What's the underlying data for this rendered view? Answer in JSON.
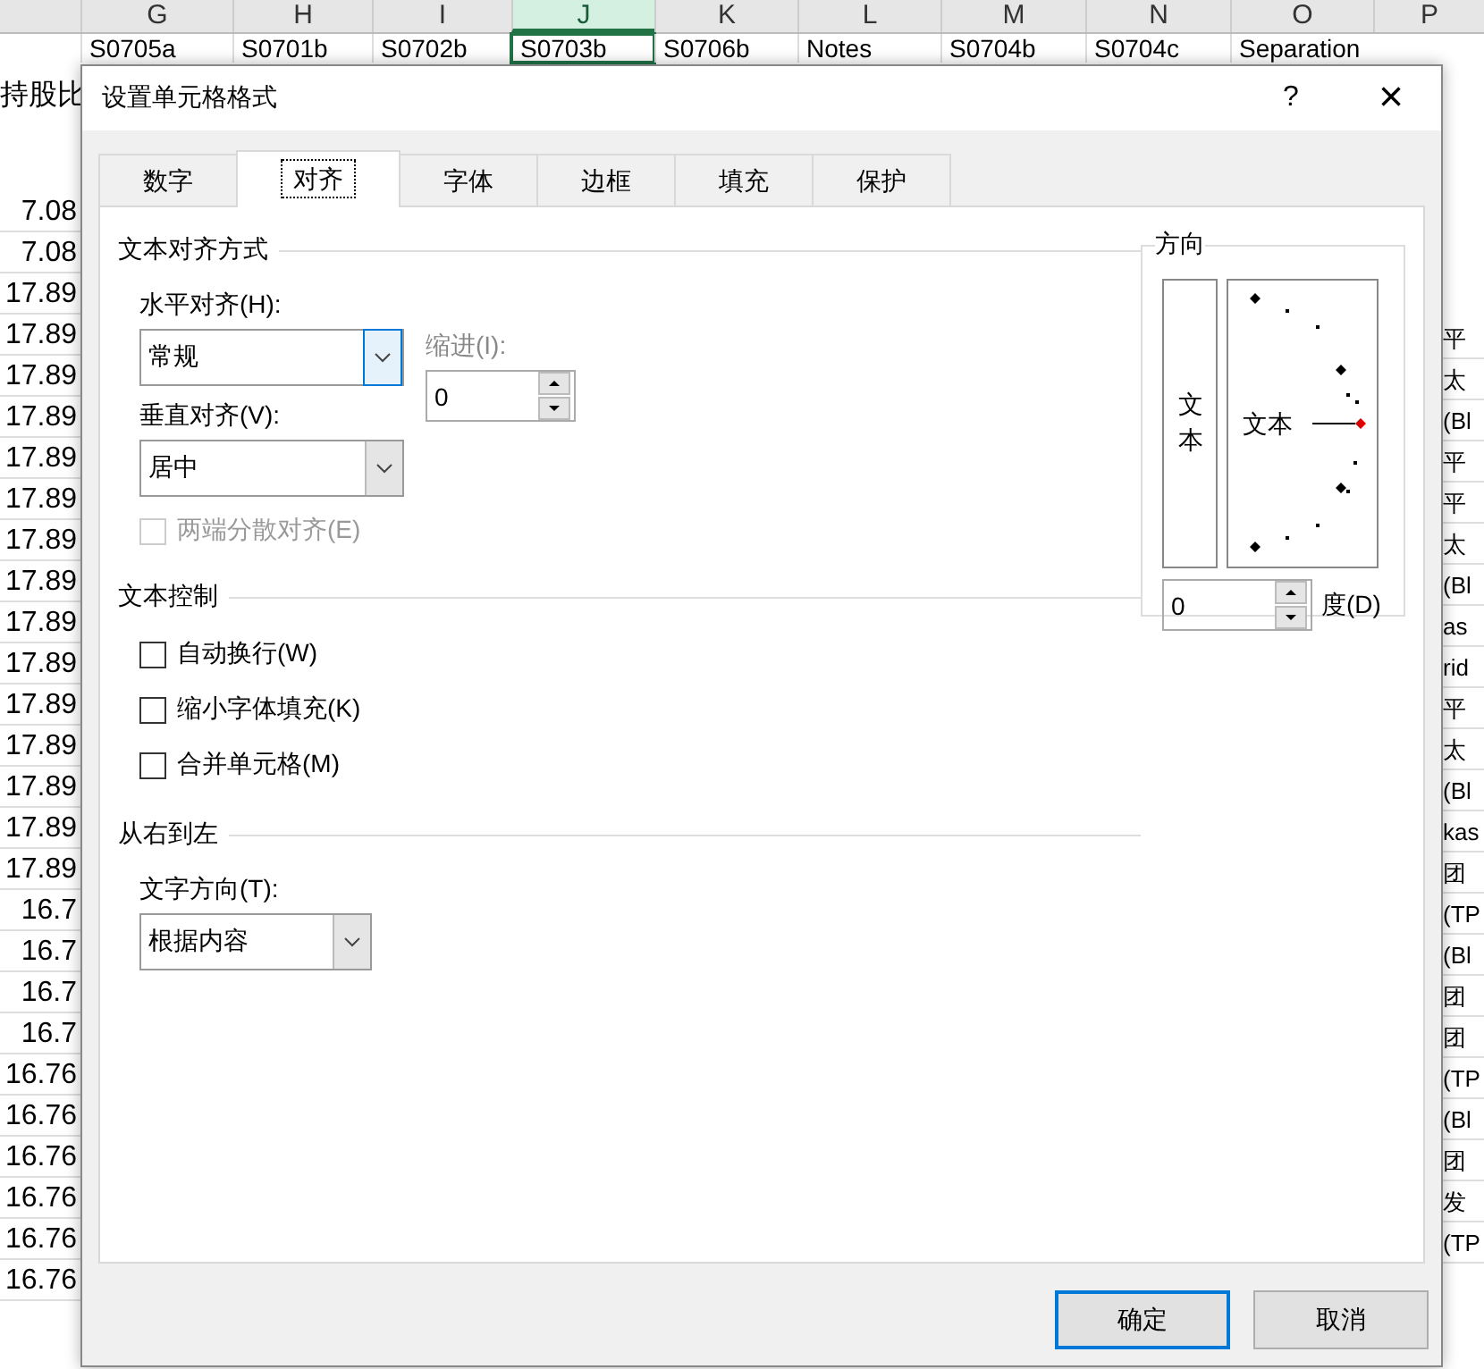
{
  "sheet": {
    "columns": [
      {
        "label": "G",
        "selected": false
      },
      {
        "label": "H",
        "selected": false
      },
      {
        "label": "I",
        "selected": false
      },
      {
        "label": "J",
        "selected": true
      },
      {
        "label": "K",
        "selected": false
      },
      {
        "label": "L",
        "selected": false
      },
      {
        "label": "M",
        "selected": false
      },
      {
        "label": "N",
        "selected": false
      },
      {
        "label": "O",
        "selected": false
      },
      {
        "label": "P",
        "selected": false
      }
    ],
    "header_row": [
      "S0705a",
      "S0701b",
      "S0702b",
      "S0703b",
      "S0706b",
      "Notes",
      "S0704b",
      "S0704c",
      "Separation"
    ],
    "left_heading": "持股比",
    "left_cells": [
      "7.08",
      "7.08",
      "17.89",
      "17.89",
      "17.89",
      "17.89",
      "17.89",
      "17.89",
      "17.89",
      "17.89",
      "17.89",
      "17.89",
      "17.89",
      "17.89",
      "17.89",
      "17.89",
      "17.89",
      "16.7",
      "16.7",
      "16.7",
      "16.7",
      "16.76",
      "16.76",
      "16.76",
      "16.76",
      "16.76",
      "16.76"
    ],
    "right_cells": [
      "平",
      "太",
      "(Bl",
      "平",
      "平",
      "太",
      "(Bl",
      "as",
      "rid",
      "平",
      "太",
      "(Bl",
      "kas",
      "团",
      "(TP",
      "(Bl",
      "团",
      "团",
      "(TP",
      "(Bl",
      "团",
      "发",
      "(TP"
    ]
  },
  "dialog": {
    "title": "设置单元格格式",
    "help": "?",
    "close": "×",
    "tabs": [
      {
        "label": "数字",
        "selected": false
      },
      {
        "label": "对齐",
        "selected": true
      },
      {
        "label": "字体",
        "selected": false
      },
      {
        "label": "边框",
        "selected": false
      },
      {
        "label": "填充",
        "selected": false
      },
      {
        "label": "保护",
        "selected": false
      }
    ],
    "alignment": {
      "title": "文本对齐方式",
      "horizontal": {
        "label": "水平对齐(H):",
        "value": "常规",
        "focused": true
      },
      "vertical": {
        "label": "垂直对齐(V):",
        "value": "居中",
        "focused": false
      },
      "indent": {
        "label": "缩进(I):",
        "value": "0"
      },
      "distributed": {
        "label": "两端分散对齐(E)",
        "checked": false,
        "disabled": true
      }
    },
    "text_control": {
      "title": "文本控制",
      "options": [
        {
          "label": "自动换行(W)",
          "checked": false,
          "disabled": false
        },
        {
          "label": "缩小字体填充(K)",
          "checked": false,
          "disabled": false
        },
        {
          "label": "合并单元格(M)",
          "checked": false,
          "disabled": false
        }
      ]
    },
    "rtl": {
      "title": "从右到左",
      "direction": {
        "label": "文字方向(T):",
        "value": "根据内容",
        "focused": false
      }
    },
    "orientation": {
      "title": "方向",
      "vertical_text": "文本",
      "dial_text": "文本",
      "degrees": {
        "value": "0",
        "label": "度(D)"
      }
    },
    "buttons": [
      {
        "label": "确定",
        "default": true
      },
      {
        "label": "取消",
        "default": false
      }
    ]
  }
}
